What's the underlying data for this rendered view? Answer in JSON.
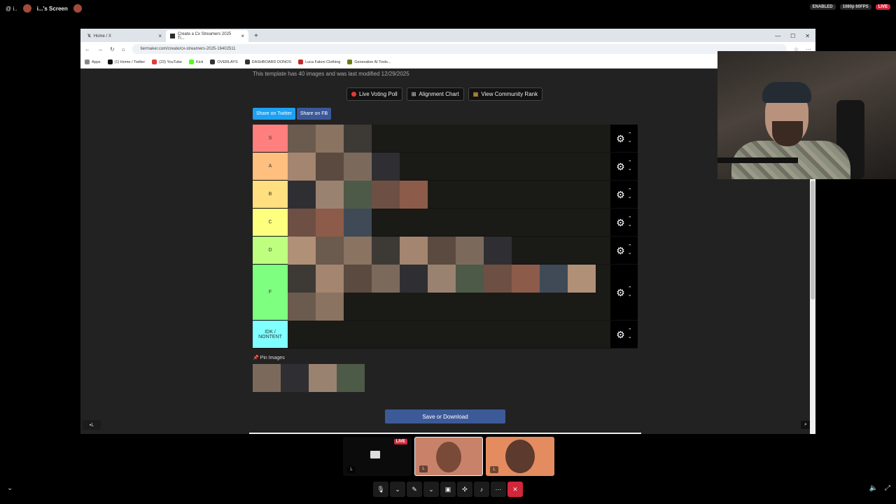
{
  "topbar": {
    "left_label_1": "@ i..",
    "left_label_2": "i...'s Screen",
    "status_enabled": "ENABLED",
    "quality": "1080p 60FPS",
    "live": "LIVE"
  },
  "browser": {
    "tabs": [
      {
        "label": "Home / X",
        "close": "×"
      },
      {
        "label": "Create a Cx Streamers 2025 Ti...",
        "close": "×"
      }
    ],
    "new_tab": "+",
    "window_controls": [
      "—",
      "☐",
      "✕"
    ],
    "url": "tiermaker.com/create/cx-streamers-2025-16402511",
    "bookmarks": [
      {
        "label": "Apps",
        "color": "#888888"
      },
      {
        "label": "(1) Home / Twitter",
        "color": "#111111"
      },
      {
        "label": "(23) YouTube",
        "color": "#e53935"
      },
      {
        "label": "Kick",
        "color": "#53fc18"
      },
      {
        "label": "OVERLAYS",
        "color": "#333333"
      },
      {
        "label": "DASHBOARD DONOS",
        "color": "#333333"
      },
      {
        "label": "Luca Faloni Clothing",
        "color": "#c62828"
      },
      {
        "label": "Generative AI Tools...",
        "color": "#6d7a12"
      }
    ]
  },
  "page": {
    "template_info": "This template has 40 images and was last modified 12/29/2025",
    "buttons": {
      "live_voting": "Live Voting Poll",
      "alignment": "Alignment Chart",
      "community": "View Community Rank"
    },
    "share_twitter": "Share on Twitter",
    "share_fb": "Share on FB",
    "pin_label": "Pin Images",
    "save_label": "Save or Download",
    "screen_label": "L"
  },
  "tiers": [
    {
      "label": "S",
      "color": "#ff7f7f",
      "count": 3
    },
    {
      "label": "A",
      "color": "#ffbf7f",
      "count": 4
    },
    {
      "label": "B",
      "color": "#ffdf7f",
      "count": 5
    },
    {
      "label": "C",
      "color": "#ffff7f",
      "count": 3
    },
    {
      "label": "D",
      "color": "#bfff7f",
      "count": 8
    },
    {
      "label": "F",
      "color": "#7fff7f",
      "count": 13
    },
    {
      "label": "IDK / NONTENT",
      "color": "#7fffff",
      "count": 0
    }
  ],
  "pin_count": 4,
  "tiles": {
    "live": "LIVE",
    "label": "L"
  }
}
